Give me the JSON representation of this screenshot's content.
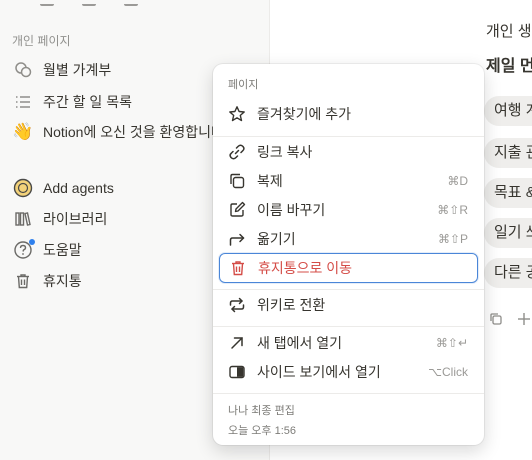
{
  "sidebar": {
    "section_label": "개인 페이지",
    "pages": [
      {
        "label": "월별 가계부",
        "icon": "coins-icon"
      },
      {
        "label": "주간 할 일 목록",
        "icon": "list-icon"
      },
      {
        "label": "Notion에 오신 것을 환영합니다",
        "icon": "wave-hand-icon"
      }
    ],
    "tools": [
      {
        "label": "Add agents",
        "icon": "agent-face-icon"
      },
      {
        "label": "라이브러리",
        "icon": "library-icon"
      },
      {
        "label": "도움말",
        "icon": "help-icon"
      },
      {
        "label": "휴지통",
        "icon": "trash-icon"
      }
    ]
  },
  "main": {
    "lines": [
      "개인 생",
      "제일 먼"
    ],
    "top_partial": "",
    "pills": [
      "여행 계",
      "지출 관",
      "목표 &",
      "일기 쓰",
      "다른 공"
    ]
  },
  "menu": {
    "header": "페이지",
    "items": {
      "favorite": {
        "label": "즐겨찾기에 추가",
        "shortcut": ""
      },
      "copy_link": {
        "label": "링크 복사",
        "shortcut": ""
      },
      "duplicate": {
        "label": "복제",
        "shortcut": "⌘D"
      },
      "rename": {
        "label": "이름 바꾸기",
        "shortcut": "⌘⇧R"
      },
      "move": {
        "label": "옮기기",
        "shortcut": "⌘⇧P"
      },
      "trash": {
        "label": "휴지통으로 이동",
        "shortcut": ""
      },
      "wiki": {
        "label": "위키로 전환",
        "shortcut": ""
      },
      "new_tab": {
        "label": "새 탭에서 열기",
        "shortcut": "⌘⇧↵"
      },
      "side_peek": {
        "label": "사이드 보기에서 열기",
        "shortcut": "⌥Click"
      }
    },
    "meta": {
      "last_edited_label": "나나 최종 편집",
      "last_edited_time": "오늘 오후 1:56"
    }
  },
  "colors": {
    "danger": "#d44c47",
    "focus_ring": "#4a86d8",
    "help_badge": "#2f80ed"
  }
}
